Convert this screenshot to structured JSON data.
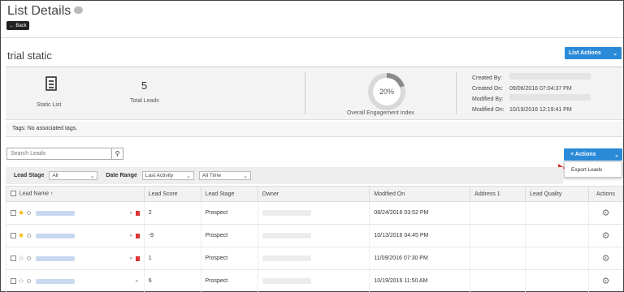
{
  "header": {
    "title": "List Details",
    "back_label": "Back"
  },
  "list_name": "trial static",
  "list_actions_label": "List Actions",
  "summary": {
    "type_label": "Static List",
    "total_leads": "5",
    "total_leads_label": "Total Leads",
    "engagement_pct": "20%",
    "engagement_fraction": 0.2,
    "engagement_label": "Overall Engagement Index",
    "meta": [
      {
        "k": "Created By:",
        "v": ""
      },
      {
        "k": "Created On:",
        "v": "09/06/2016 07:04:37 PM"
      },
      {
        "k": "Modified By:",
        "v": ""
      },
      {
        "k": "Modified On:",
        "v": "10/19/2016 12:19:41 PM"
      }
    ]
  },
  "tags": {
    "label": "Tags:",
    "value": "No associated tags."
  },
  "search": {
    "placeholder": "Search Leads"
  },
  "actions": {
    "label": "Actions",
    "menu_item": "Export Leads"
  },
  "filters": {
    "lead_stage_label": "Lead Stage",
    "lead_stage_value": "All",
    "date_range_label": "Date Range",
    "date_field_value": "Last Activity",
    "date_period_value": "All Time"
  },
  "table": {
    "headers": [
      "Lead Name",
      "Lead Score",
      "Lead Stage",
      "Owner",
      "Modified On",
      "Address 1",
      "Lead Quality",
      "Actions"
    ],
    "rows": [
      {
        "score": "2",
        "stage": "Prospect",
        "modified": "08/24/2016 03:52 PM",
        "starred": true,
        "flag": true
      },
      {
        "score": "-9",
        "stage": "Prospect",
        "modified": "10/13/2016 04:45 PM",
        "starred": true,
        "flag": true
      },
      {
        "score": "1",
        "stage": "Prospect",
        "modified": "11/09/2016 07:30 PM",
        "starred": false,
        "flag": true
      },
      {
        "score": "6",
        "stage": "Prospect",
        "modified": "10/19/2016 11:50 AM",
        "starred": false,
        "flag": false
      }
    ]
  },
  "colors": {
    "accent": "#2b8ad8",
    "flag": "#dd3333",
    "star": "#f5b400",
    "arrow": "#dd3322"
  }
}
